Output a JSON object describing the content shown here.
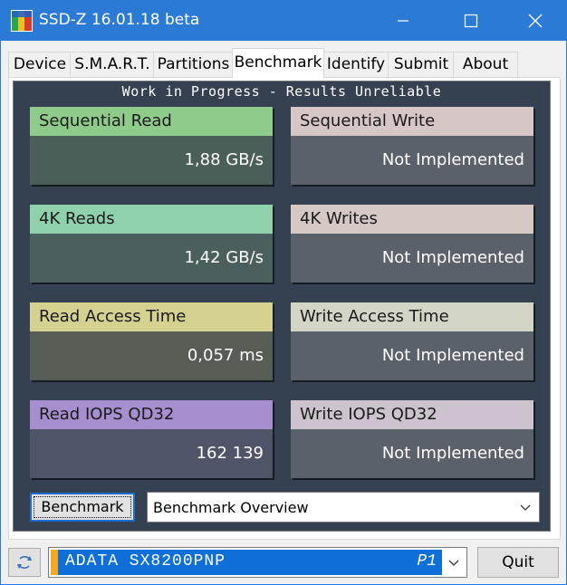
{
  "window": {
    "title": "SSD-Z 16.01.18 beta"
  },
  "tabs": [
    {
      "label": "Device"
    },
    {
      "label": "S.M.A.R.T."
    },
    {
      "label": "Partitions"
    },
    {
      "label": "Benchmark",
      "active": true
    },
    {
      "label": "Identify"
    },
    {
      "label": "Submit"
    },
    {
      "label": "About"
    }
  ],
  "benchmark": {
    "banner": "Work in Progress - Results Unreliable",
    "cards": [
      {
        "label": "Sequential Read",
        "value": "1,88 GB/s",
        "head_color": "#8fcc8c",
        "body_color": "#4b5e58"
      },
      {
        "label": "Sequential Write",
        "value": "Not Implemented",
        "head_color": "#d6c6c5",
        "body_color": "#5b616a"
      },
      {
        "label": "4K Reads",
        "value": "1,42 GB/s",
        "head_color": "#8fd0ad",
        "body_color": "#4a5f5e"
      },
      {
        "label": "4K Writes",
        "value": "Not Implemented",
        "head_color": "#d6c9c5",
        "body_color": "#5b616a"
      },
      {
        "label": "Read Access Time",
        "value": "0,057 ms",
        "head_color": "#d5d191",
        "body_color": "#575c55"
      },
      {
        "label": "Write Access Time",
        "value": "Not Implemented",
        "head_color": "#d3d5c7",
        "body_color": "#5b616a"
      },
      {
        "label": "Read IOPS QD32",
        "value": "162 139",
        "head_color": "#a78fcf",
        "body_color": "#4f5468"
      },
      {
        "label": "Write IOPS QD32",
        "value": "Not Implemented",
        "head_color": "#cdc3cf",
        "body_color": "#5b616a"
      }
    ],
    "button_label": "Benchmark",
    "view_select": "Benchmark Overview"
  },
  "footer": {
    "drive_name": "ADATA SX8200PNP",
    "drive_badge": "P1",
    "quit_label": "Quit"
  }
}
